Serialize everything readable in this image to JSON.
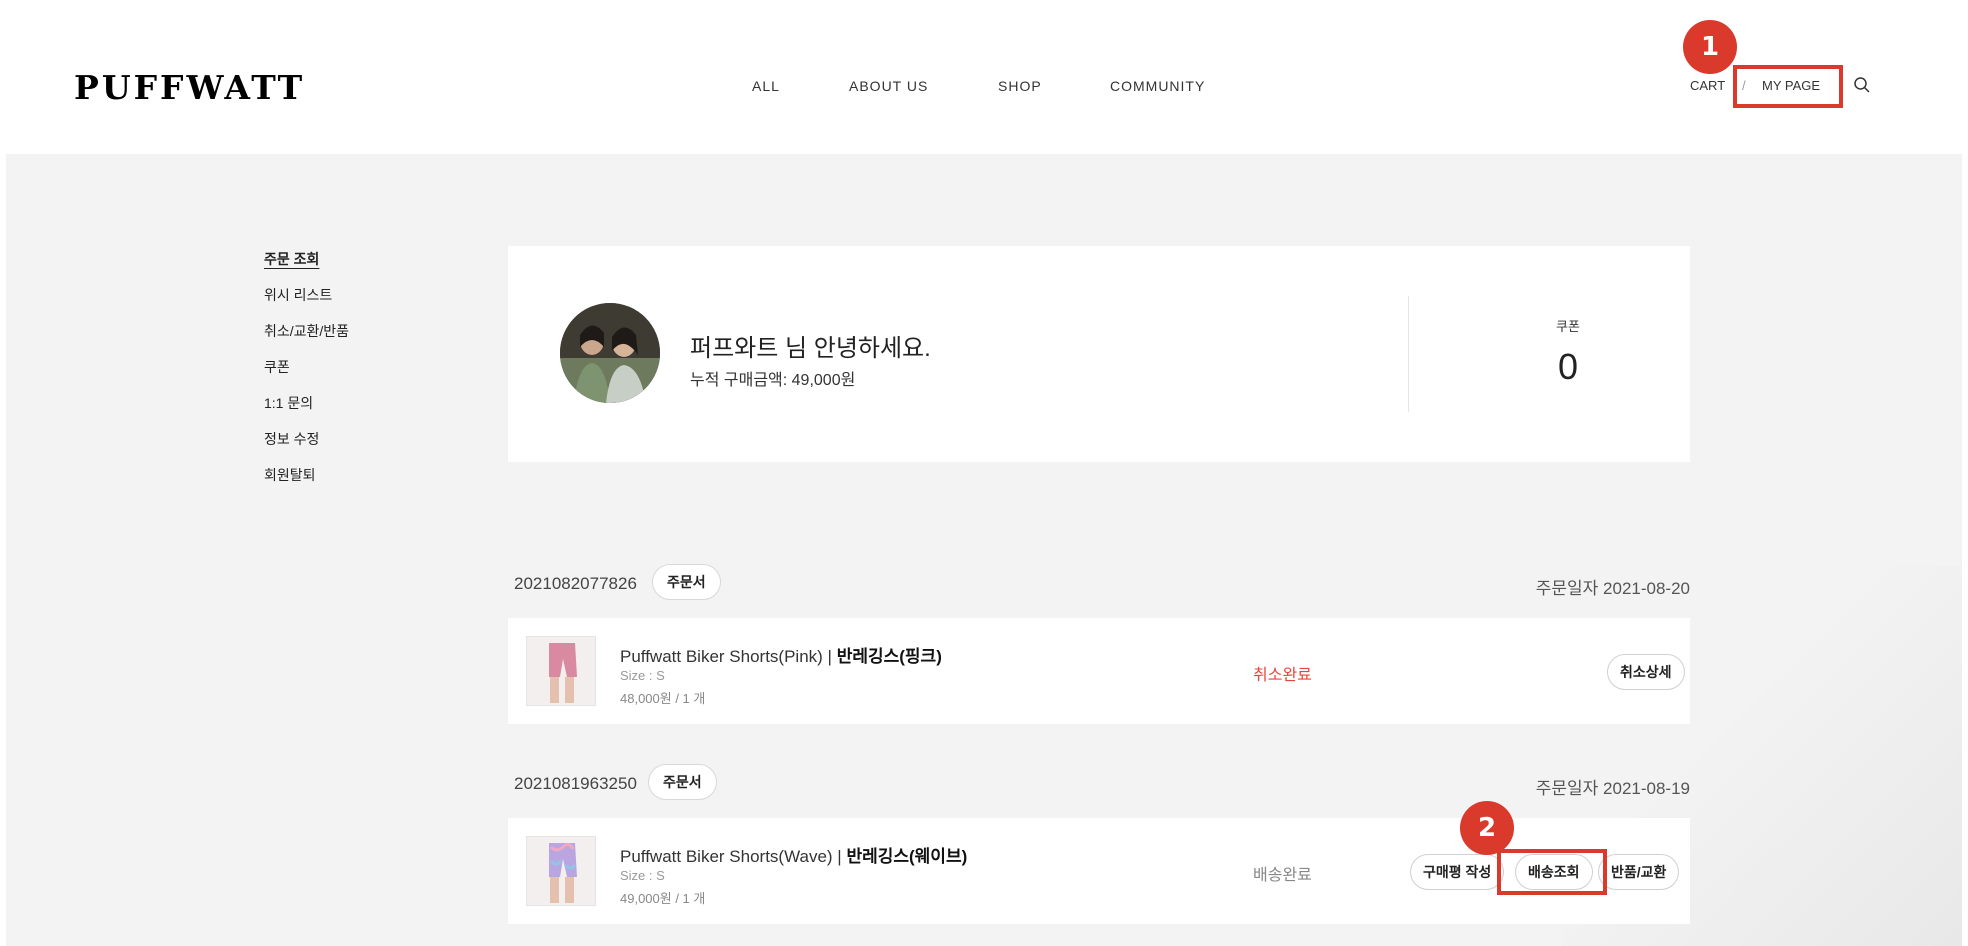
{
  "header": {
    "logo": "PUFFWATT",
    "nav": [
      "ALL",
      "ABOUT US",
      "SHOP",
      "COMMUNITY"
    ],
    "cart": "CART",
    "separator": "/",
    "mypage": "MY PAGE",
    "search_icon": "search-icon"
  },
  "markers": [
    "1",
    "2"
  ],
  "sidebar": {
    "items": [
      {
        "label": "주문 조회",
        "active": true
      },
      {
        "label": "위시 리스트"
      },
      {
        "label": "취소/교환/반품"
      },
      {
        "label": "쿠폰"
      },
      {
        "label": "1:1 문의"
      },
      {
        "label": "정보 수정"
      },
      {
        "label": "회원탈퇴"
      }
    ]
  },
  "profile": {
    "greeting": "퍼프와트 님 안녕하세요.",
    "total_purchase": "누적 구매금액: 49,000원",
    "coupon_label": "쿠폰",
    "coupon_count": "0"
  },
  "orders": [
    {
      "order_no": "2021082077826",
      "sheet_label": "주문서",
      "date_label": "주문일자",
      "date": "2021-08-20",
      "product_en": "Puffwatt Biker Shorts(Pink) | ",
      "product_ko": "반레깅스(핑크)",
      "size": "Size : S",
      "price": "48,000원 / 1 개",
      "status": "취소완료",
      "status_color": "#e8453c",
      "buttons": [
        "취소상세"
      ]
    },
    {
      "order_no": "2021081963250",
      "sheet_label": "주문서",
      "date_label": "주문일자",
      "date": "2021-08-19",
      "product_en": "Puffwatt Biker Shorts(Wave) | ",
      "product_ko": "반레깅스(웨이브)",
      "size": "Size : S",
      "price": "49,000원 / 1 개",
      "status": "배송완료",
      "status_color": "#888888",
      "buttons": [
        "구매평 작성",
        "배송조회",
        "반품/교환"
      ]
    }
  ],
  "colors": {
    "accent_highlight": "#d93a2b",
    "background": "#f3f3f3"
  }
}
